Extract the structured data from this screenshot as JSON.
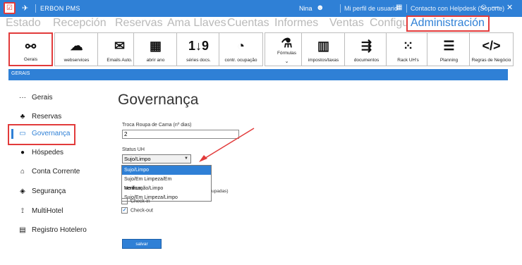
{
  "titlebar": {
    "app_name": "ERBON PMS",
    "user": "Nina",
    "profile": "Mi perfil de usuario",
    "contact": "Contacto con Helpdesk (Soporte)",
    "minimize": "—",
    "close": "✕"
  },
  "menu": [
    "Estado",
    "Recepción",
    "Reservas",
    "Ama Llaves",
    "Cuentas",
    "Informes",
    "Ventas",
    "Configuraciones",
    "Administración"
  ],
  "toolbar": [
    {
      "label": "Gerais",
      "icon": "steam-icon"
    },
    {
      "label": "webservices",
      "icon": "cloud-icon"
    },
    {
      "label": "Emails Auto.",
      "icon": "envelope-icon"
    },
    {
      "label": "abrir ano",
      "icon": "calendar-icon"
    },
    {
      "label": "séries docs.",
      "icon": "sort-numeric-icon"
    },
    {
      "label": "contr. ocupação",
      "icon": "gauge-icon"
    },
    {
      "label": "Fórmulas",
      "icon": "flask-icon"
    },
    {
      "label": "impostos/taxas",
      "icon": "building-icon"
    },
    {
      "label": "documentos",
      "icon": "train-icon"
    },
    {
      "label": "Rack UH's",
      "icon": "grid-icon"
    },
    {
      "label": "Planning",
      "icon": "align-center-icon"
    },
    {
      "label": "Regras de Negócio",
      "icon": "code-icon"
    }
  ],
  "section": "GERAIS",
  "sidebar": [
    {
      "label": "Gerais",
      "icon": "ellipsis-icon"
    },
    {
      "label": "Reservas",
      "icon": "piggy-bank-icon"
    },
    {
      "label": "Governança",
      "icon": "bed-icon"
    },
    {
      "label": "Hóspedes",
      "icon": "user-icon"
    },
    {
      "label": "Conta Corrente",
      "icon": "bank-icon"
    },
    {
      "label": "Segurança",
      "icon": "shield-icon"
    },
    {
      "label": "MultiHotel",
      "icon": "antenna-icon"
    },
    {
      "label": "Registro Hotelero",
      "icon": "document-icon"
    }
  ],
  "page": {
    "title": "Governança",
    "troca_label": "Troca Roupa de Cama (nº dias)",
    "troca_value": "2",
    "status_label": "Status UH",
    "status_value": "Sujo/Limpo",
    "status_options": [
      "Sujo/Limpo",
      "Sujo/Em Limpeza/Em Verificação/Limpo",
      "Nenhum",
      "Sujo/Em Limpeza/Limpo"
    ],
    "hidden_label_fragment": "upadas)",
    "checkin_label": "Check-in",
    "checkout_label": "Check-out",
    "save_label": "salvar"
  },
  "colors": {
    "accent": "#2f80d6",
    "highlight": "#e23b3b"
  }
}
